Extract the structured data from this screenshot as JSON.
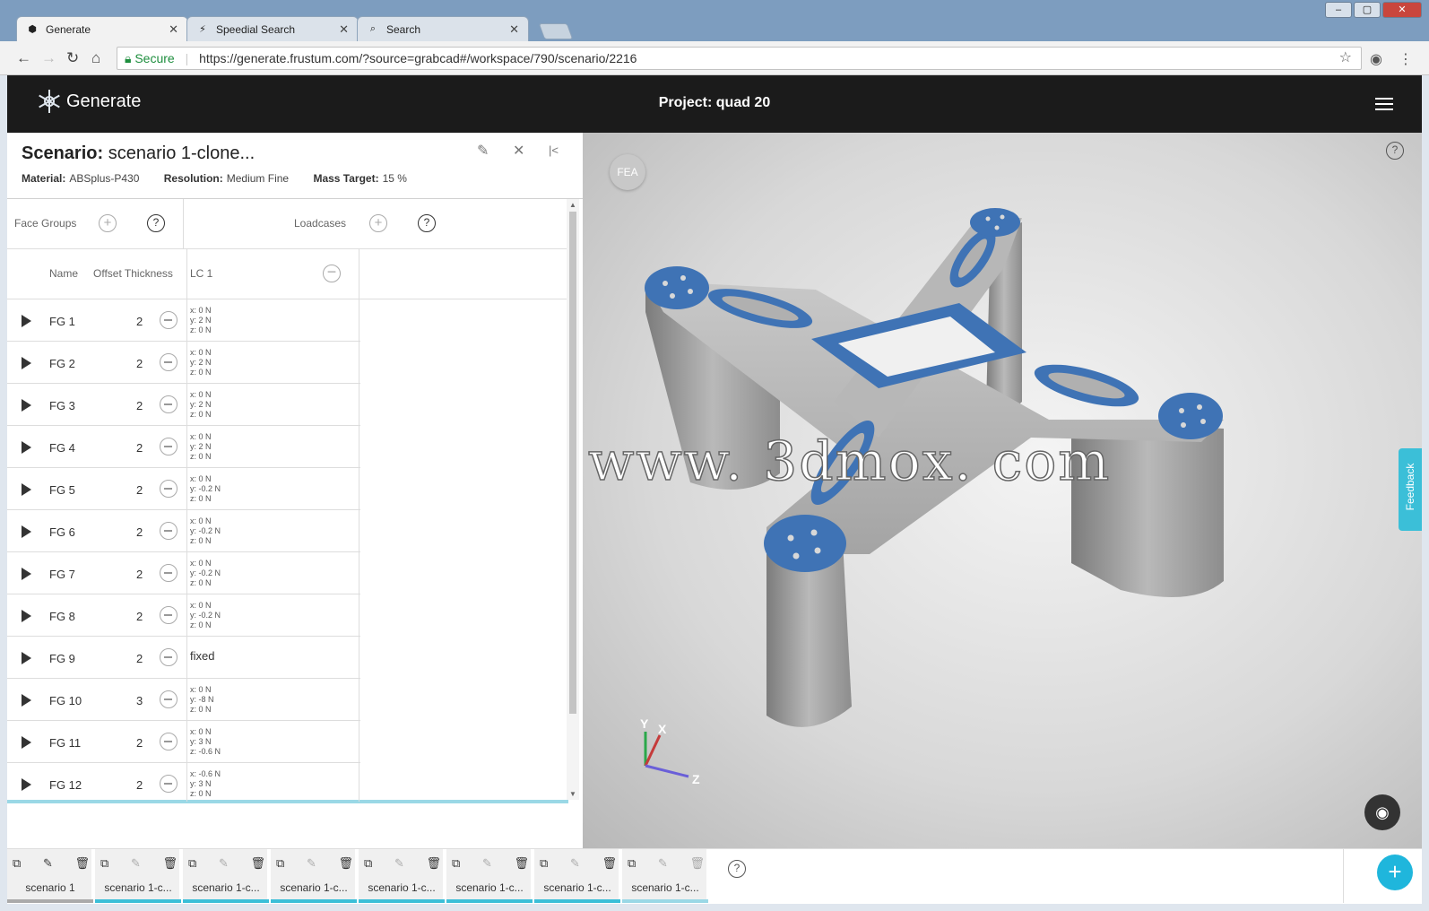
{
  "browser": {
    "tabs": [
      {
        "label": "Generate",
        "icon": "generate-icon"
      },
      {
        "label": "Speedial Search",
        "icon": "speedial-icon"
      },
      {
        "label": "Search",
        "icon": "search-icon"
      }
    ],
    "secure_label": "Secure",
    "url": "https://generate.frustum.com/?source=grabcad#/workspace/790/scenario/2216"
  },
  "app": {
    "logo_text": "Generate",
    "project_title": "Project: quad 20"
  },
  "scenario": {
    "title_label": "Scenario:",
    "title_value": "scenario 1-clone...",
    "material_label": "Material:",
    "material_value": "ABSplus-P430",
    "resolution_label": "Resolution:",
    "resolution_value": "Medium Fine",
    "mass_label": "Mass Target:",
    "mass_value": "15 %"
  },
  "panel": {
    "face_groups_label": "Face Groups",
    "loadcases_label": "Loadcases",
    "col_name": "Name",
    "col_offset": "Offset Thickness",
    "col_lc": "LC 1",
    "help_glyph": "?",
    "add_glyph": "+"
  },
  "face_groups": [
    {
      "name": "FG 1",
      "thickness": "2",
      "load": [
        "x: 0 N",
        "y: 2 N",
        "z: 0 N"
      ]
    },
    {
      "name": "FG 2",
      "thickness": "2",
      "load": [
        "x: 0 N",
        "y: 2 N",
        "z: 0 N"
      ]
    },
    {
      "name": "FG 3",
      "thickness": "2",
      "load": [
        "x: 0 N",
        "y: 2 N",
        "z: 0 N"
      ]
    },
    {
      "name": "FG 4",
      "thickness": "2",
      "load": [
        "x: 0 N",
        "y: 2 N",
        "z: 0 N"
      ]
    },
    {
      "name": "FG 5",
      "thickness": "2",
      "load": [
        "x: 0 N",
        "y: -0.2 N",
        "z: 0 N"
      ]
    },
    {
      "name": "FG 6",
      "thickness": "2",
      "load": [
        "x: 0 N",
        "y: -0.2 N",
        "z: 0 N"
      ]
    },
    {
      "name": "FG 7",
      "thickness": "2",
      "load": [
        "x: 0 N",
        "y: -0.2 N",
        "z: 0 N"
      ]
    },
    {
      "name": "FG 8",
      "thickness": "2",
      "load": [
        "x: 0 N",
        "y: -0.2 N",
        "z: 0 N"
      ]
    },
    {
      "name": "FG 9",
      "thickness": "2",
      "load": [
        "fixed",
        "",
        ""
      ]
    },
    {
      "name": "FG 10",
      "thickness": "3",
      "load": [
        "x: 0 N",
        "y: -8 N",
        "z: 0 N"
      ]
    },
    {
      "name": "FG 11",
      "thickness": "2",
      "load": [
        "x: 0 N",
        "y: 3 N",
        "z: -0.6 N"
      ]
    },
    {
      "name": "FG 12",
      "thickness": "2",
      "load": [
        "x: -0.6 N",
        "y: 3 N",
        "z: 0 N"
      ]
    }
  ],
  "viewport": {
    "fea_label": "FEA",
    "feedback_label": "Feedback",
    "watermark": "莫西网www. 3dmox. com",
    "axis_x": "X",
    "axis_y": "Y",
    "axis_z": "Z",
    "model_gray": "#9a9a9a",
    "face_blue": "#3f73b5"
  },
  "scenario_tabs": [
    {
      "label": "scenario 1"
    },
    {
      "label": "scenario 1-c..."
    },
    {
      "label": "scenario 1-c..."
    },
    {
      "label": "scenario 1-c..."
    },
    {
      "label": "scenario 1-c..."
    },
    {
      "label": "scenario 1-c..."
    },
    {
      "label": "scenario 1-c..."
    },
    {
      "label": "scenario 1-c..."
    }
  ],
  "fab_glyph": "+"
}
